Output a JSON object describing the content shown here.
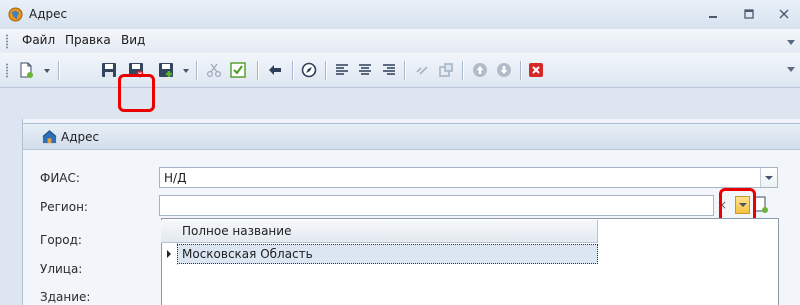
{
  "window": {
    "title": "Адрес"
  },
  "menu": {
    "items": [
      "Файл",
      "Правка",
      "Вид"
    ]
  },
  "panel": {
    "title": "Адрес"
  },
  "form": {
    "fias": {
      "label": "ФИАС:",
      "value": "Н/Д"
    },
    "region": {
      "label": "Регион:",
      "value": "",
      "clear_glyph": "×"
    },
    "city": {
      "label": "Город:"
    },
    "street": {
      "label": "Улица:"
    },
    "building": {
      "label": "Здание:"
    }
  },
  "dropdown": {
    "columns": [
      "Полное название"
    ],
    "rows": [
      {
        "full_name": "Московская Область",
        "current": true
      }
    ]
  },
  "colors": {
    "highlight": "#ea0000",
    "title_bg": "#dde6f0",
    "selection": "#dce6f3"
  }
}
